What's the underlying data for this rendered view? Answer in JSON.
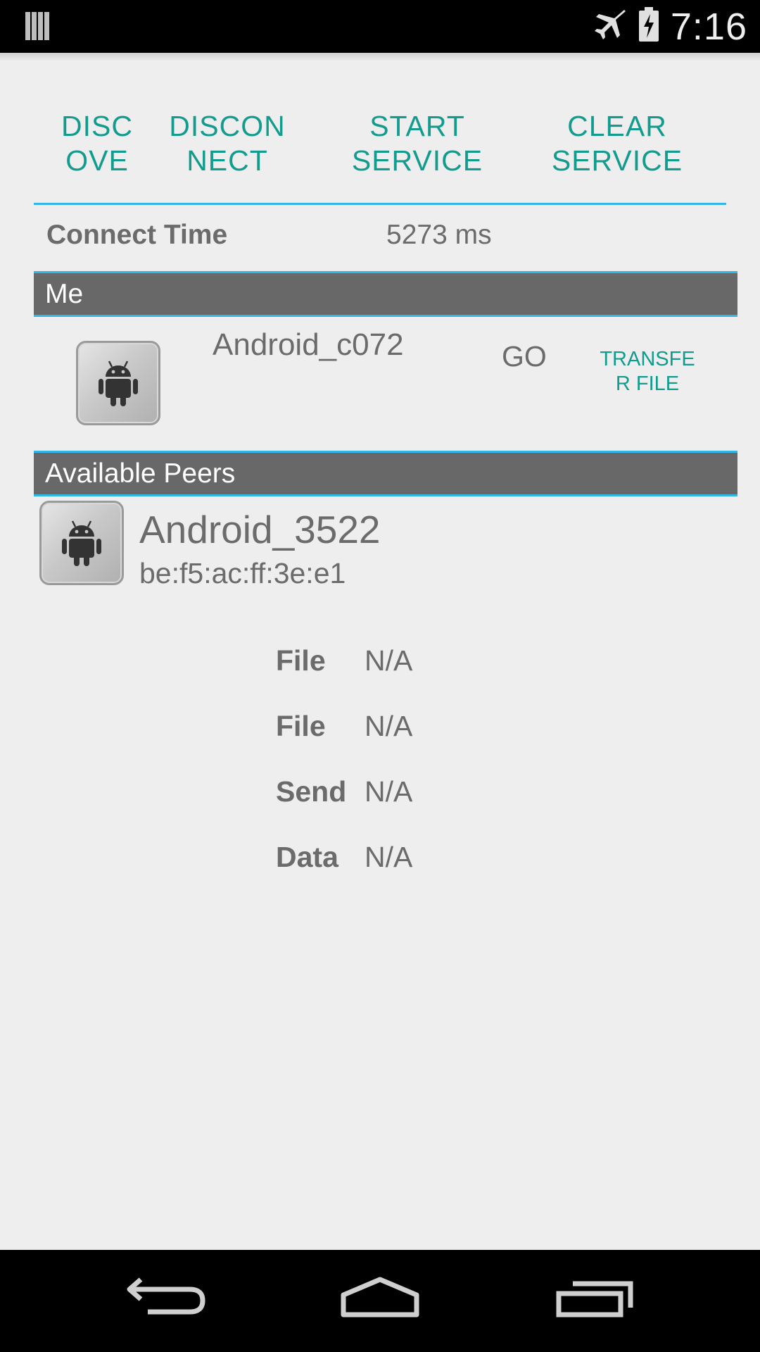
{
  "status_bar": {
    "time": "7:16",
    "icons": [
      "notification-bars-icon",
      "airplane-mode-icon",
      "battery-charging-icon"
    ]
  },
  "toolbar": {
    "discover_label": "DISC\nOVE",
    "disconnect_label": "DISCON\nNECT",
    "start_service_label": "START\nSERVICE",
    "clear_service_label": "CLEAR\nSERVICE"
  },
  "connect_time": {
    "label": "Connect Time",
    "value": "5273 ms"
  },
  "me_section": {
    "header": "Me",
    "device_name": "Android_c072",
    "role": "GO",
    "transfer_label": "TRANSFE\nR FILE",
    "avatar_icon": "android-robot-icon"
  },
  "peers_section": {
    "header": "Available Peers",
    "peers": [
      {
        "name": "Android_3522",
        "mac": "be:f5:ac:ff:3e:e1",
        "avatar_icon": "android-robot-icon"
      }
    ]
  },
  "file_info": [
    {
      "key": "File",
      "value": "N/A"
    },
    {
      "key": "File",
      "value": "N/A"
    },
    {
      "key": "Send",
      "value": "N/A"
    },
    {
      "key": "Data",
      "value": "N/A"
    }
  ],
  "nav_bar": {
    "icons": [
      "back-icon",
      "home-icon",
      "recent-apps-icon"
    ]
  },
  "colors": {
    "accent_teal": "#139c8e",
    "rule_blue": "#33b5e5",
    "header_gray": "#686868",
    "text_gray": "#6b6b6b",
    "background": "#eeeeee"
  }
}
